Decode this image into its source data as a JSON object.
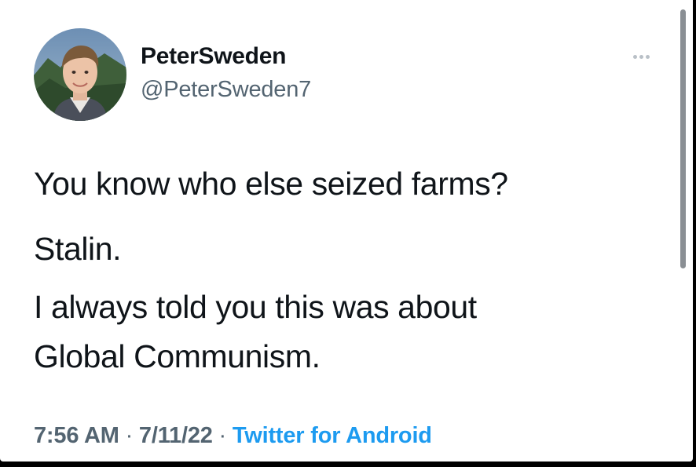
{
  "tweet": {
    "author": {
      "display_name": "PeterSweden",
      "handle": "@PeterSweden7"
    },
    "text_lines": [
      "You know who else seized farms?",
      "Stalin.",
      "I always told you this was about",
      "Global Communism."
    ],
    "time": "7:56 AM",
    "separator": "·",
    "date": "7/11/22",
    "source": "Twitter for Android",
    "more_icon": "more-horizontal-icon"
  },
  "colors": {
    "background": "#ffffff",
    "text_primary": "#0f1419",
    "text_secondary": "#536471",
    "link": "#1d9bf0"
  }
}
